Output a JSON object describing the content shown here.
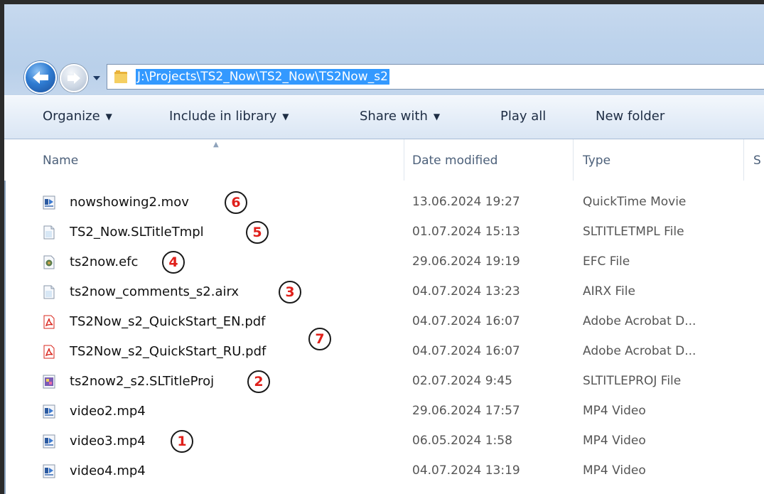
{
  "address_bar": {
    "path": "J:\\Projects\\TS2_Now\\TS2_Now\\TS2Now_s2"
  },
  "command_bar": {
    "organize": "Organize",
    "include_in_library": "Include in library",
    "share_with": "Share with",
    "play_all": "Play all",
    "new_folder": "New folder"
  },
  "columns": {
    "name": "Name",
    "date_modified": "Date modified",
    "type": "Type",
    "size_partial": "S"
  },
  "files": [
    {
      "name": "nowshowing2.mov",
      "date": "13.06.2024 19:27",
      "type": "QuickTime Movie",
      "icon": "video-file-icon",
      "marker": "6"
    },
    {
      "name": "TS2_Now.SLTitleTmpl",
      "date": "01.07.2024 15:13",
      "type": "SLTITLETMPL File",
      "icon": "generic-file-icon",
      "marker": "5"
    },
    {
      "name": "ts2now.efc",
      "date": "29.06.2024 19:19",
      "type": "EFC File",
      "icon": "efc-file-icon",
      "marker": "4"
    },
    {
      "name": "ts2now_comments_s2.airx",
      "date": "04.07.2024 13:23",
      "type": "AIRX File",
      "icon": "generic-file-icon",
      "marker": "3"
    },
    {
      "name": "TS2Now_s2_QuickStart_EN.pdf",
      "date": "04.07.2024 16:07",
      "type": "Adobe Acrobat D...",
      "icon": "pdf-file-icon",
      "marker": ""
    },
    {
      "name": "TS2Now_s2_QuickStart_RU.pdf",
      "date": "04.07.2024 16:07",
      "type": "Adobe Acrobat D...",
      "icon": "pdf-file-icon",
      "marker": ""
    },
    {
      "name": "ts2now2_s2.SLTitleProj",
      "date": "02.07.2024 9:45",
      "type": "SLTITLEPROJ File",
      "icon": "project-file-icon",
      "marker": "2"
    },
    {
      "name": "video2.mp4",
      "date": "29.06.2024 17:57",
      "type": "MP4 Video",
      "icon": "video-file-icon",
      "marker": ""
    },
    {
      "name": "video3.mp4",
      "date": "06.05.2024 1:58",
      "type": "MP4 Video",
      "icon": "video-file-icon",
      "marker": "1"
    },
    {
      "name": "video4.mp4",
      "date": "04.07.2024 13:19",
      "type": "MP4 Video",
      "icon": "video-file-icon",
      "marker": ""
    }
  ],
  "pdf_group_marker": "7",
  "colors": {
    "selection": "#3399ff",
    "marker_text": "#e0201b",
    "pdf_icon": "#d9271e"
  }
}
